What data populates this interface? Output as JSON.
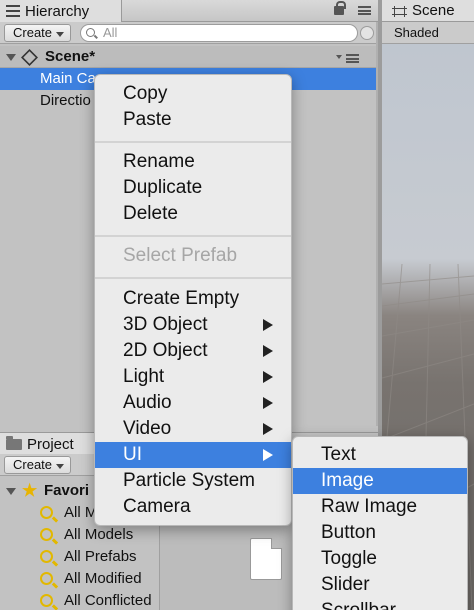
{
  "hierarchy": {
    "tab_label": "Hierarchy",
    "create_label": "Create",
    "search_placeholder": "All",
    "scene_name": "Scene*",
    "rows": [
      {
        "label": "Main Ca",
        "selected": true
      },
      {
        "label": "Directio",
        "selected": false
      }
    ]
  },
  "scene_panel": {
    "tab_label": "Scene",
    "shading_mode": "Shaded"
  },
  "project": {
    "tab_label": "Project",
    "create_label": "Create",
    "favorites_label": "Favori",
    "favorites": [
      "All M",
      "All Models",
      "All Prefabs",
      "All Modified",
      "All Conflicted"
    ]
  },
  "context_menu": {
    "items": [
      {
        "label": "Copy"
      },
      {
        "label": "Paste"
      },
      {
        "label": "Rename"
      },
      {
        "label": "Duplicate"
      },
      {
        "label": "Delete"
      },
      {
        "label": "Select Prefab",
        "disabled": true
      },
      {
        "label": "Create Empty"
      },
      {
        "label": "3D Object",
        "submenu": true
      },
      {
        "label": "2D Object",
        "submenu": true
      },
      {
        "label": "Light",
        "submenu": true
      },
      {
        "label": "Audio",
        "submenu": true
      },
      {
        "label": "Video",
        "submenu": true
      },
      {
        "label": "UI",
        "submenu": true,
        "highlighted": true
      },
      {
        "label": "Particle System"
      },
      {
        "label": "Camera"
      }
    ]
  },
  "ui_submenu": {
    "items": [
      {
        "label": "Text"
      },
      {
        "label": "Image",
        "highlighted": true
      },
      {
        "label": "Raw Image"
      },
      {
        "label": "Button"
      },
      {
        "label": "Toggle"
      },
      {
        "label": "Slider"
      },
      {
        "label": "Scrollbar"
      }
    ]
  },
  "colors": {
    "selection": "#3d80df",
    "menu_background": "#ebebeb",
    "panel_background": "#c2c2c2",
    "favorite_icon": "#e2b800"
  }
}
